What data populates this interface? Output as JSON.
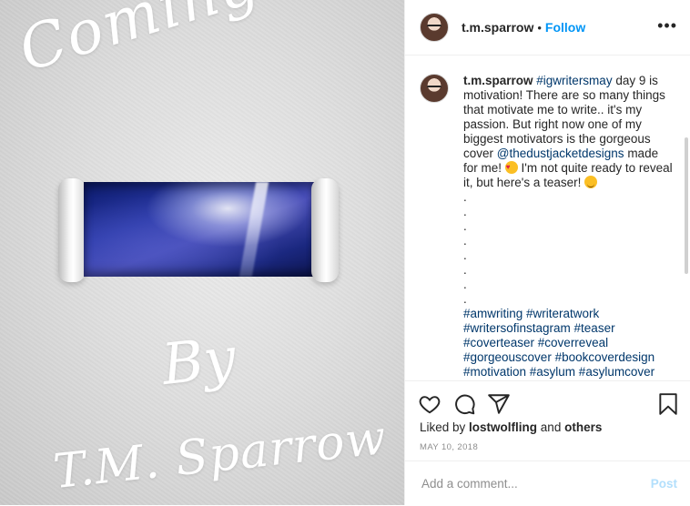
{
  "image": {
    "headline": "Coming Soon",
    "by_text": "By",
    "author_text": "T.M. Sparrow"
  },
  "header": {
    "username": "t.m.sparrow",
    "separator": "•",
    "follow_label": "Follow",
    "more_label": "•••"
  },
  "caption": {
    "username": "t.m.sparrow",
    "tag_igwritersmay": "#igwritersmay",
    "text_1": " day 9 is motivation! There are so many things that motivate me to write.. it's my passion. But right now one of my biggest motivators is the gorgeous cover ",
    "mention": "@thedustjacketdesigns",
    "text_2": " made for me! ",
    "text_3": " I'm not quite ready to reveal it, but here's a teaser! ",
    "dots": [
      ".",
      ".",
      ".",
      ".",
      ".",
      ".",
      ".",
      "."
    ],
    "hashtag_lines": [
      "#amwriting #writeratwork",
      "#writersofinstagram #teaser",
      "#coverteaser #coverreveal",
      "#gorgeouscover #bookcoverdesign",
      "#motivation #asylum #asylumcover"
    ]
  },
  "actions": {
    "icons": [
      "heart-icon",
      "comment-icon",
      "share-icon",
      "bookmark-icon"
    ]
  },
  "likes": {
    "prefix": "Liked by ",
    "user": "lostwolfling",
    "middle": " and ",
    "others": "others"
  },
  "date": "MAY 10, 2018",
  "comment": {
    "placeholder": "Add a comment...",
    "post_label": "Post"
  },
  "colors": {
    "link_blue": "#0095f6",
    "hashtag": "#00376b",
    "post_disabled": "#b2dffc",
    "meta_gray": "#8e8e8e"
  }
}
